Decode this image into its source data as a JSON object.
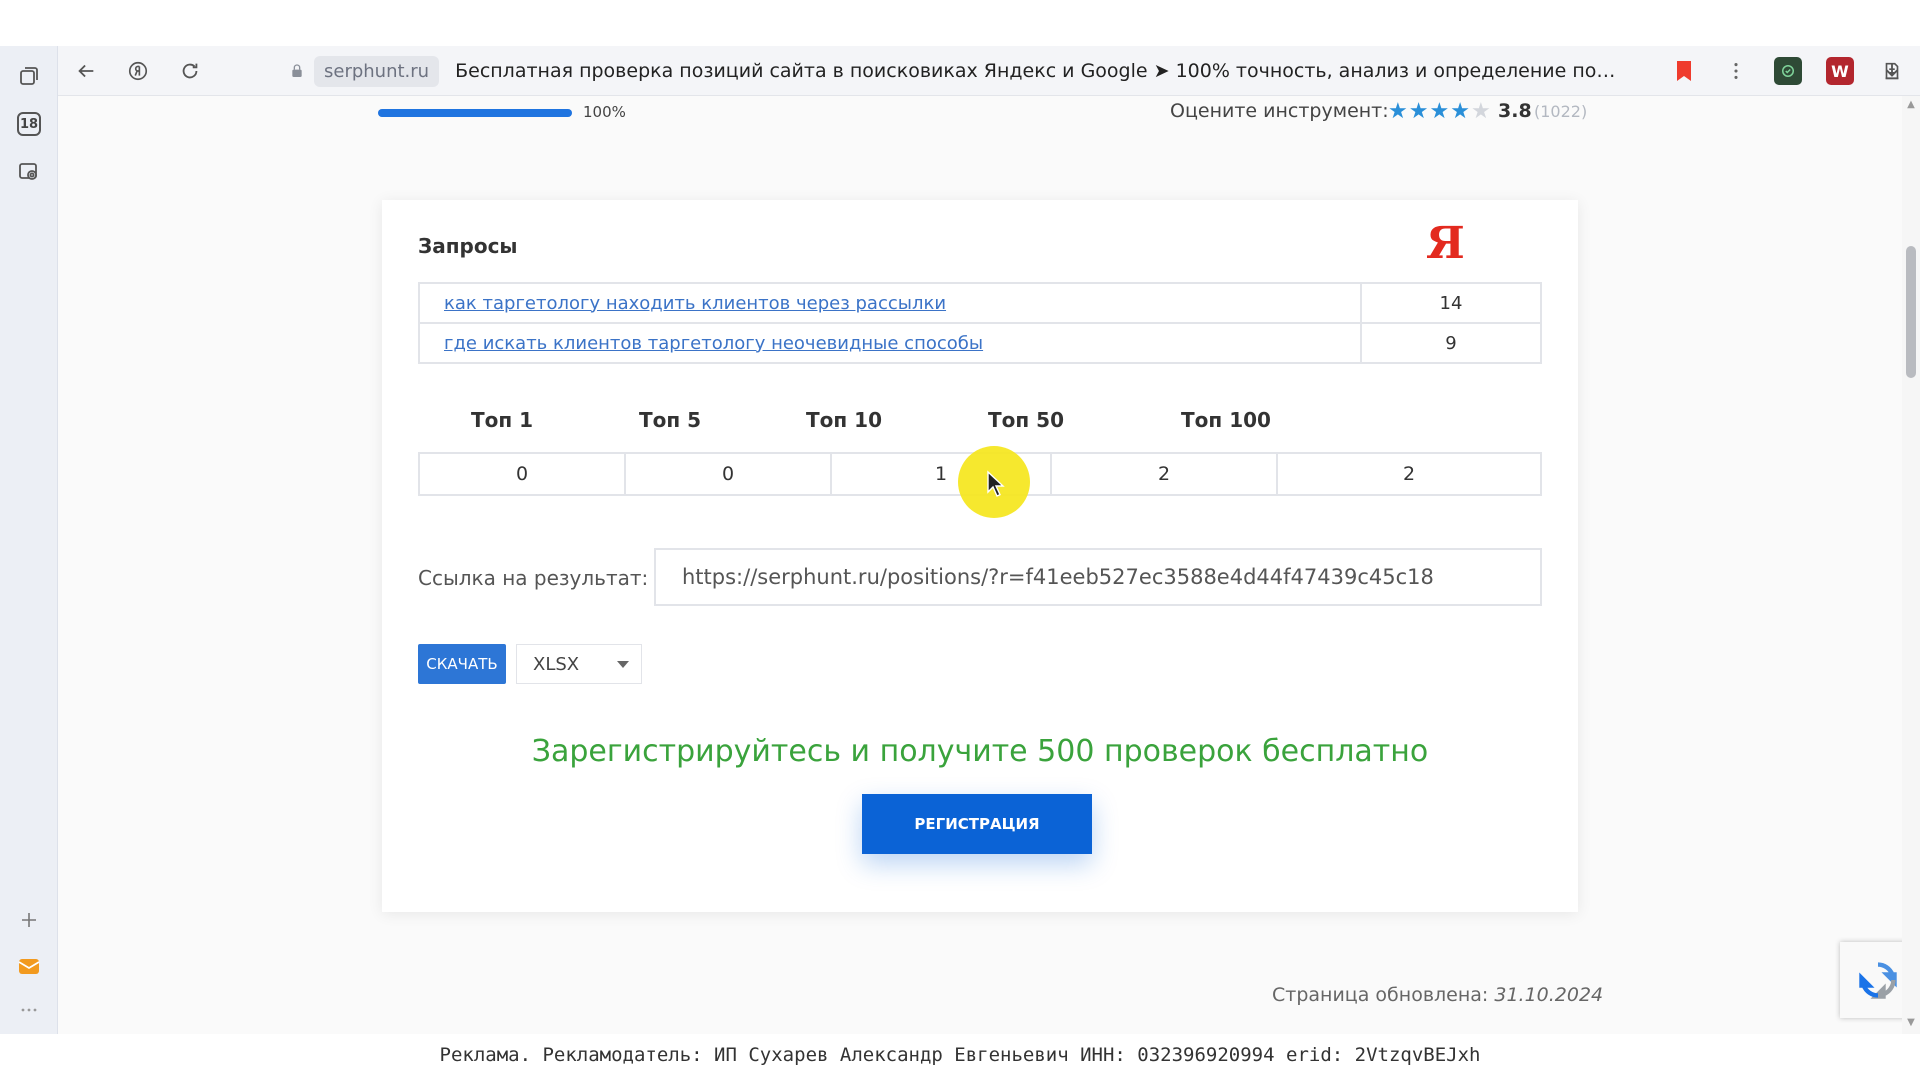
{
  "browser": {
    "domain": "serphunt.ru",
    "tab_title": "Бесплатная проверка позиций сайта в поисковиках Яндекс и Google ➤ 100% точность, анализ и определение позиций запросов...",
    "sidebar_badge": "18"
  },
  "progress": {
    "value": 100,
    "label": "100%"
  },
  "rating": {
    "label": "Оцените инструмент:",
    "stars_filled": 4,
    "stars_total": 5,
    "value": "3.8",
    "count": "(1022)",
    "star_color": "#2a8fd8"
  },
  "card": {
    "title": "Запросы",
    "engine_logo": "Я",
    "queries": [
      {
        "text": "как таргетологу находить клиентов через рассылки",
        "position": "14"
      },
      {
        "text": "где искать клиентов таргетологу неочевидные способы",
        "position": "9"
      }
    ],
    "tops": [
      {
        "label": "Топ 1",
        "value": "0"
      },
      {
        "label": "Топ 5",
        "value": "0"
      },
      {
        "label": "Топ 10",
        "value": "1"
      },
      {
        "label": "Топ 50",
        "value": "2"
      },
      {
        "label": "Топ 100",
        "value": "2"
      }
    ],
    "link_label": "Ссылка на результат:",
    "link_value": "https://serphunt.ru/positions/?r=f41eeb527ec3588e4d44f47439c45c18",
    "download_label": "СКАЧАТЬ",
    "format_value": "XLSX",
    "promo_text": "Зарегистрируйтесь и получите 500 проверок бесплатно",
    "register_label": "РЕГИСТРАЦИЯ"
  },
  "footer": {
    "updated_label": "Страница обновлена:",
    "updated_date": "31.10.2024",
    "ad_text": "Реклама. Рекламодатель: ИП Сухарев Александр Евгеньевич ИНН: 032396920994 erid: 2VtzqvBEJxh"
  },
  "colors": {
    "accent_blue": "#2d76d6",
    "promo_green": "#3aa33c",
    "yandex_red": "#e32a1f",
    "cursor_highlight": "#f5e61c"
  }
}
